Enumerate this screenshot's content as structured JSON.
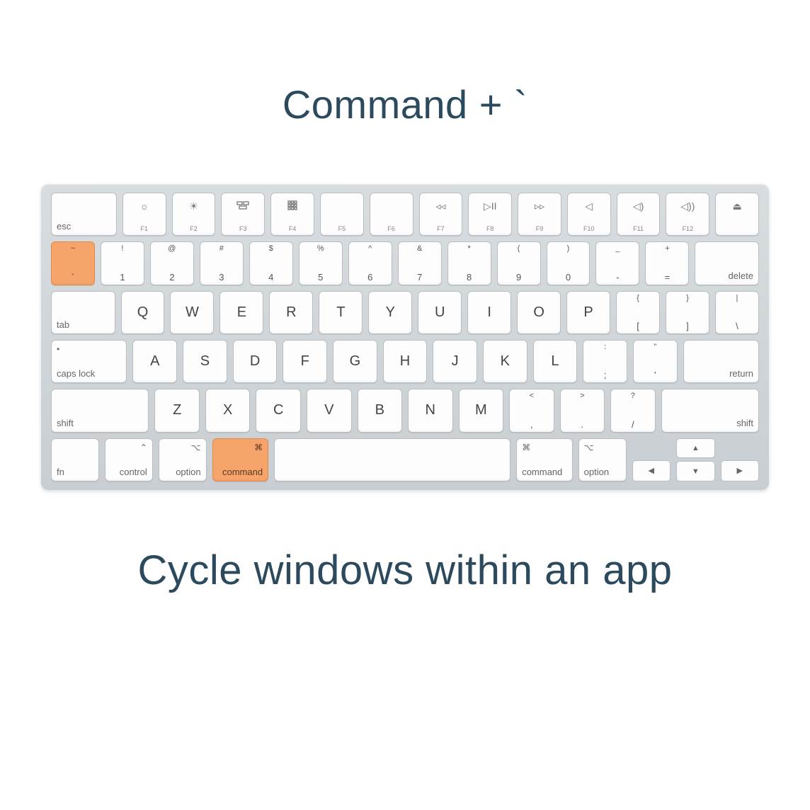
{
  "title": "Command + `",
  "caption": "Cycle windows within an app",
  "highlight_color": "#f6a46b",
  "rows": {
    "fn": {
      "esc": "esc",
      "f": [
        "F1",
        "F2",
        "F3",
        "F4",
        "F5",
        "F6",
        "F7",
        "F8",
        "F9",
        "F10",
        "F11",
        "F12"
      ]
    },
    "num": {
      "backtick": {
        "top": "~",
        "bot": "`",
        "highlighted": true
      },
      "keys": [
        {
          "top": "!",
          "bot": "1"
        },
        {
          "top": "@",
          "bot": "2"
        },
        {
          "top": "#",
          "bot": "3"
        },
        {
          "top": "$",
          "bot": "4"
        },
        {
          "top": "%",
          "bot": "5"
        },
        {
          "top": "^",
          "bot": "6"
        },
        {
          "top": "&",
          "bot": "7"
        },
        {
          "top": "*",
          "bot": "8"
        },
        {
          "top": "(",
          "bot": "9"
        },
        {
          "top": ")",
          "bot": "0"
        },
        {
          "top": "_",
          "bot": "-"
        },
        {
          "top": "+",
          "bot": "="
        }
      ],
      "delete": "delete"
    },
    "qw": {
      "tab": "tab",
      "letters": [
        "Q",
        "W",
        "E",
        "R",
        "T",
        "Y",
        "U",
        "I",
        "O",
        "P"
      ],
      "br1": {
        "top": "{",
        "bot": "["
      },
      "br2": {
        "top": "}",
        "bot": "]"
      },
      "bsls": {
        "top": "|",
        "bot": "\\"
      }
    },
    "as": {
      "caps": "caps lock",
      "caps_sym": "•",
      "letters": [
        "A",
        "S",
        "D",
        "F",
        "G",
        "H",
        "J",
        "K",
        "L"
      ],
      "semi": {
        "top": ":",
        "bot": ";"
      },
      "quote": {
        "top": "\"",
        "bot": "'"
      },
      "return": "return"
    },
    "zx": {
      "shift_l": "shift",
      "letters": [
        "Z",
        "X",
        "C",
        "V",
        "B",
        "N",
        "M"
      ],
      "comma": {
        "top": "<",
        "bot": ","
      },
      "period": {
        "top": ">",
        "bot": "."
      },
      "slash": {
        "top": "?",
        "bot": "/"
      },
      "shift_r": "shift"
    },
    "mod": {
      "fn": "fn",
      "control": "control",
      "option_l": "option",
      "command_l": {
        "label": "command",
        "highlighted": true
      },
      "command_r": "command",
      "option_r": "option"
    }
  }
}
